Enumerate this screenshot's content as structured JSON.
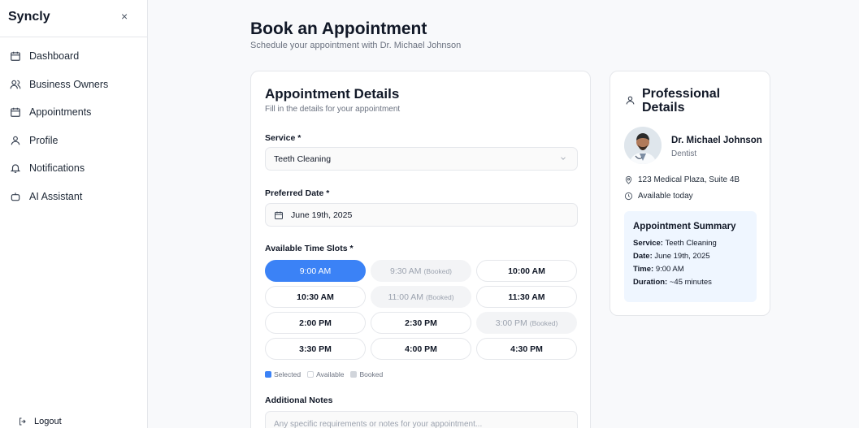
{
  "sidebar": {
    "brand": "Syncly",
    "close": "×",
    "items": [
      {
        "label": "Dashboard",
        "icon": "calendar-icon"
      },
      {
        "label": "Business Owners",
        "icon": "users-icon"
      },
      {
        "label": "Appointments",
        "icon": "calendar-icon"
      },
      {
        "label": "Profile",
        "icon": "user-icon"
      },
      {
        "label": "Notifications",
        "icon": "bell-icon"
      },
      {
        "label": "AI Assistant",
        "icon": "bot-icon"
      }
    ],
    "logout": "Logout"
  },
  "header": {
    "title": "Book an Appointment",
    "subtitle": "Schedule your appointment with Dr. Michael Johnson"
  },
  "details": {
    "title": "Appointment Details",
    "subtitle": "Fill in the details for your appointment",
    "service_label": "Service *",
    "service_value": "Teeth Cleaning",
    "date_label": "Preferred Date *",
    "date_value": "June 19th, 2025",
    "slots_label": "Available Time Slots *",
    "slots": [
      {
        "time": "9:00 AM",
        "status": "selected"
      },
      {
        "time": "9:30 AM",
        "status": "booked"
      },
      {
        "time": "10:00 AM",
        "status": "available"
      },
      {
        "time": "10:30 AM",
        "status": "available"
      },
      {
        "time": "11:00 AM",
        "status": "booked"
      },
      {
        "time": "11:30 AM",
        "status": "available"
      },
      {
        "time": "2:00 PM",
        "status": "available"
      },
      {
        "time": "2:30 PM",
        "status": "available"
      },
      {
        "time": "3:00 PM",
        "status": "booked"
      },
      {
        "time": "3:30 PM",
        "status": "available"
      },
      {
        "time": "4:00 PM",
        "status": "available"
      },
      {
        "time": "4:30 PM",
        "status": "available"
      }
    ],
    "booked_suffix": "(Booked)",
    "legend": {
      "selected": "Selected",
      "available": "Available",
      "booked": "Booked"
    },
    "notes_label": "Additional Notes",
    "notes_placeholder": "Any specific requirements or notes for your appointment..."
  },
  "professional": {
    "title": "Professional Details",
    "name": "Dr. Michael Johnson",
    "role": "Dentist",
    "address": "123 Medical Plaza, Suite 4B",
    "availability": "Available today",
    "summary": {
      "title": "Appointment Summary",
      "service_key": "Service:",
      "service_val": "Teeth Cleaning",
      "date_key": "Date:",
      "date_val": "June 19th, 2025",
      "time_key": "Time:",
      "time_val": "9:00 AM",
      "duration_key": "Duration:",
      "duration_val": "~45 minutes"
    }
  },
  "colors": {
    "accent": "#3b82f6",
    "summary_bg": "#eff6ff",
    "booked_bg": "#f3f4f6"
  }
}
